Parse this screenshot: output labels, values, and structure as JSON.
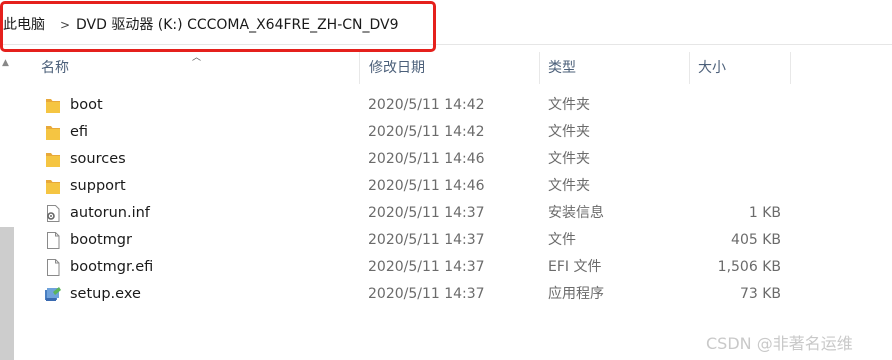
{
  "breadcrumb": {
    "root": "此电脑",
    "separator": ">",
    "current": "DVD 驱动器 (K:) CCCOMA_X64FRE_ZH-CN_DV9"
  },
  "columns": {
    "name": "名称",
    "date": "修改日期",
    "type": "类型",
    "size": "大小"
  },
  "files": [
    {
      "name": "boot",
      "date": "2020/5/11 14:42",
      "type": "文件夹",
      "size": "",
      "icon": "folder-icon"
    },
    {
      "name": "efi",
      "date": "2020/5/11 14:42",
      "type": "文件夹",
      "size": "",
      "icon": "folder-icon"
    },
    {
      "name": "sources",
      "date": "2020/5/11 14:46",
      "type": "文件夹",
      "size": "",
      "icon": "folder-icon"
    },
    {
      "name": "support",
      "date": "2020/5/11 14:46",
      "type": "文件夹",
      "size": "",
      "icon": "folder-icon"
    },
    {
      "name": "autorun.inf",
      "date": "2020/5/11 14:37",
      "type": "安装信息",
      "size": "1 KB",
      "icon": "settings-file-icon"
    },
    {
      "name": "bootmgr",
      "date": "2020/5/11 14:37",
      "type": "文件",
      "size": "405 KB",
      "icon": "file-icon"
    },
    {
      "name": "bootmgr.efi",
      "date": "2020/5/11 14:37",
      "type": "EFI 文件",
      "size": "1,506 KB",
      "icon": "file-icon"
    },
    {
      "name": "setup.exe",
      "date": "2020/5/11 14:37",
      "type": "应用程序",
      "size": "73 KB",
      "icon": "setup-app-icon"
    }
  ],
  "watermark": "CSDN @非著名运维",
  "colors": {
    "highlight_border": "#e5201c",
    "folder": "#f5c542",
    "header_text": "#4c607a"
  }
}
